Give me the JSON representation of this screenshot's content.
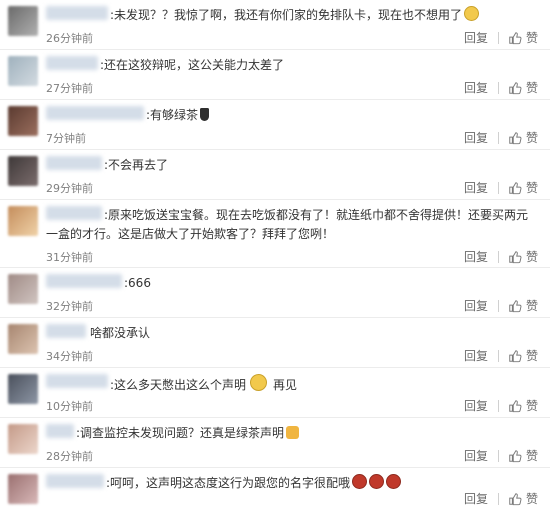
{
  "comments": [
    {
      "text": ":未发现？？我惊了啊，我还有你们家的免排队卡，现在也不想用了",
      "time": "26分钟前",
      "reply": "回复",
      "like": "赞",
      "emoji": "sad-face",
      "avatar_color": "#8e8e8e",
      "name_color": "#d8dde3"
    },
    {
      "text": ":还在这狡辩呢，这公关能力太差了",
      "time": "27分钟前",
      "reply": "回复",
      "like": "赞",
      "emoji": "",
      "avatar_color": "#a7b6c1",
      "name_color": "#d6dee8"
    },
    {
      "text": ":有够绿茶",
      "time": "7分钟前",
      "reply": "回复",
      "like": "赞",
      "emoji": "tea",
      "avatar_color": "#6e4a3d",
      "name_color": "#c9d6e6"
    },
    {
      "text": ":不会再去了",
      "time": "29分钟前",
      "reply": "回复",
      "like": "赞",
      "emoji": "",
      "avatar_color": "#4e4646",
      "name_color": "#cdd8e8"
    },
    {
      "text": ":原来吃饭送宝宝餐。现在去吃饭都没有了！就连纸巾都不舍得提供！还要买两元一盒的才行。这是店做大了开始欺客了？拜拜了您咧！",
      "time": "31分钟前",
      "reply": "回复",
      "like": "赞",
      "emoji": "",
      "avatar_color": "#d9a877",
      "name_color": "#d9e0ea"
    },
    {
      "text": ":666",
      "time": "32分钟前",
      "reply": "回复",
      "like": "赞",
      "emoji": "",
      "avatar_color": "#a79895",
      "name_color": "#d4dde9"
    },
    {
      "text": "啥都没承认",
      "time": "34分钟前",
      "reply": "回复",
      "like": "赞",
      "emoji": "",
      "avatar_color": "#b89b86",
      "name_color": "#cdd9e8"
    },
    {
      "text": ":这么多天憋出这么个声明",
      "text2": "再见",
      "time": "10分钟前",
      "reply": "回复",
      "like": "赞",
      "emoji": "smile",
      "avatar_color": "#59606e",
      "name_color": "#cfd9e6"
    },
    {
      "text": ":调查监控未发现问题？还真是绿茶声明",
      "time": "28分钟前",
      "reply": "回复",
      "like": "赞",
      "emoji": "thumbs-up",
      "avatar_color": "#cfa896",
      "name_color": "#cdd9ea"
    },
    {
      "text": ":呵呵，这声明这态度这行为跟您的名字很配哦",
      "time": "",
      "reply": "回复",
      "like": "赞",
      "emoji": "hot-pot",
      "avatar_color": "#b78c8c",
      "name_color": "#d6dee8"
    }
  ]
}
